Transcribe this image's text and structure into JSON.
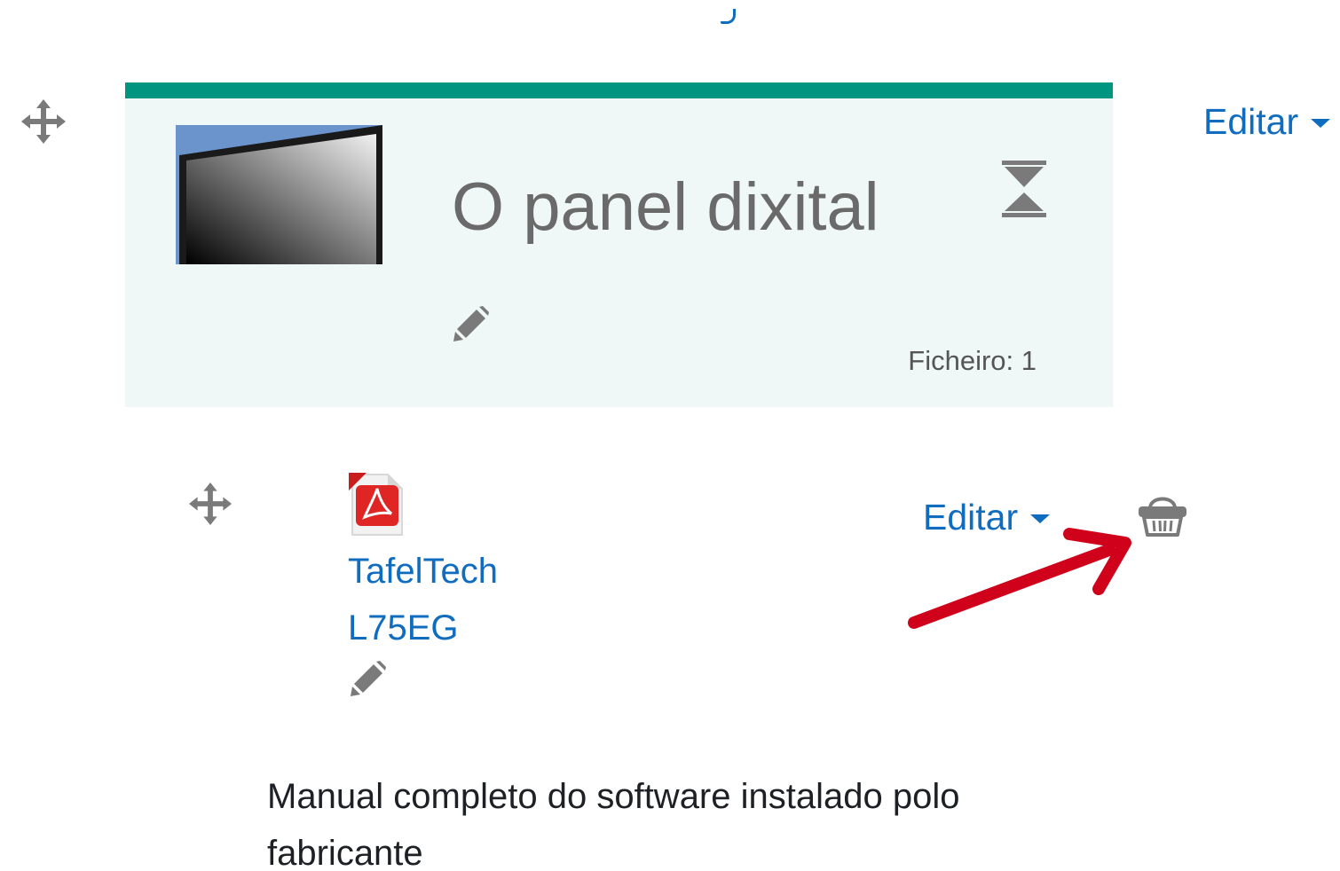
{
  "section": {
    "title": "O panel dixital",
    "file_count": "Ficheiro: 1",
    "edit_label": "Editar",
    "accent_color": "#00957f",
    "background_color": "#eff8f6",
    "thumbnail_icon": "display-screen-image",
    "restriction_icon": "hourglass-icon",
    "edit_title_icon": "pencil-icon",
    "move_icon": "move-icon"
  },
  "activity": {
    "type_icon": "pdf-icon",
    "name_line1": "TafelTech",
    "name_line2": "L75EG",
    "edit_label": "Editar",
    "edit_name_icon": "pencil-icon",
    "move_icon": "move-icon",
    "extra_icon": "basket-icon",
    "description_line1": "Manual completo do software instalado polo",
    "description_line2": "fabricante"
  },
  "annotation": {
    "arrow_color": "#d0021b",
    "target": "basket-icon"
  },
  "colors": {
    "link": "#0f6cbf",
    "title_text": "#6a6a6a",
    "icon_gray": "#7a7a7a",
    "body_text": "#1d2125"
  }
}
